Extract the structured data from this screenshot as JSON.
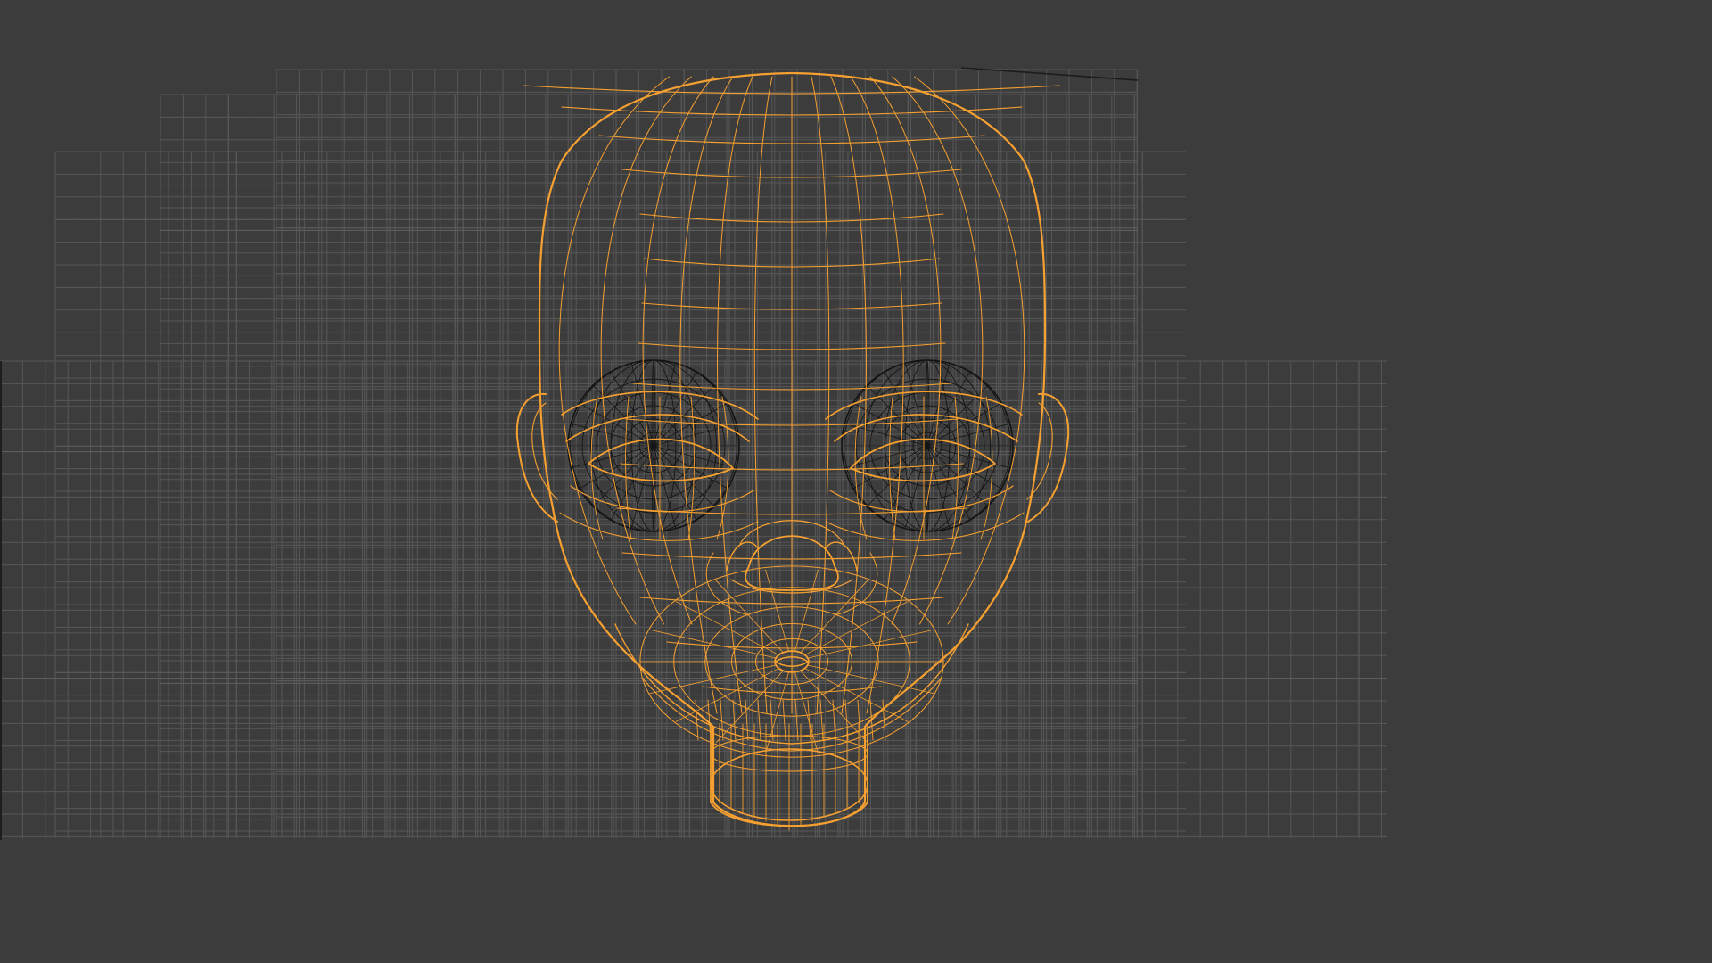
{
  "viewport": {
    "view": "front",
    "display_mode": "wireframe",
    "colors": {
      "background": "#3c3c3c",
      "grid_minor": "#575757",
      "grid_major": "#606060",
      "selected_wire": "#f5a030",
      "unselected_wire": "#151515"
    },
    "objects": [
      {
        "name": "head-mesh",
        "selected": true
      },
      {
        "name": "eyeball-left",
        "selected": false
      },
      {
        "name": "eyeball-right",
        "selected": false
      }
    ]
  }
}
